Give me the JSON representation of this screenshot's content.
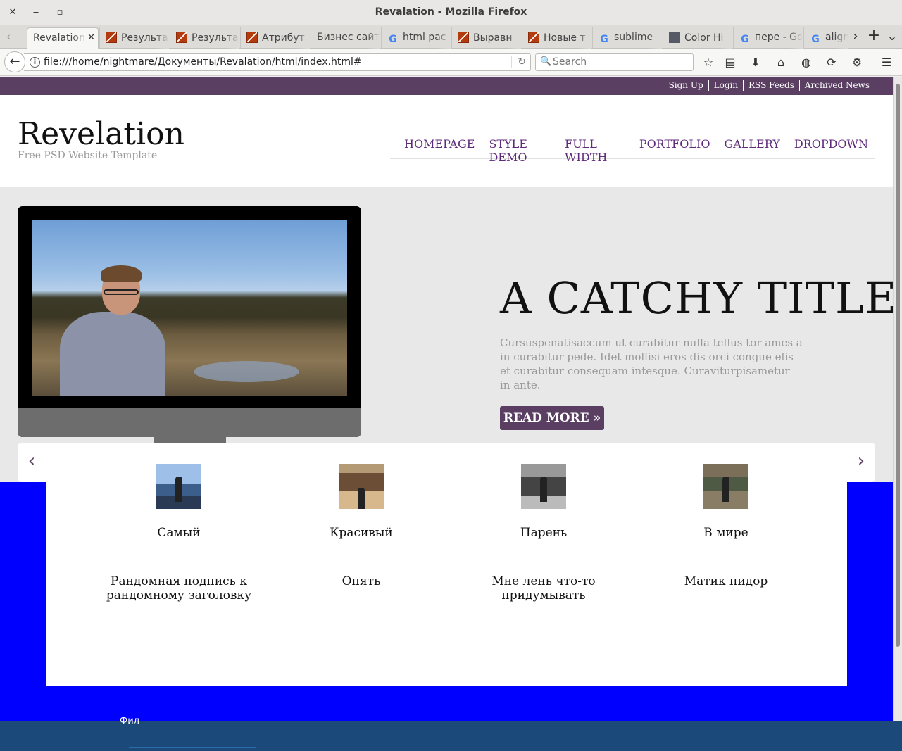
{
  "window": {
    "title": "Revalation - Mozilla Firefox",
    "close": "✕",
    "minimize": "‒",
    "maximize": "▫"
  },
  "tabs": [
    {
      "label": "Revalation",
      "active": true,
      "favicon": "none"
    },
    {
      "label": "Результа",
      "favicon": "orange-grid-icon"
    },
    {
      "label": "Результа",
      "favicon": "orange-grid-icon"
    },
    {
      "label": "Атрибут",
      "favicon": "orange-grid-icon"
    },
    {
      "label": "Бизнес сайт",
      "favicon": "none"
    },
    {
      "label": "html pac",
      "favicon": "google-icon"
    },
    {
      "label": "Выравн",
      "favicon": "orange-grid-icon"
    },
    {
      "label": "Новые т",
      "favicon": "orange-grid-icon"
    },
    {
      "label": "sublime",
      "favicon": "google-icon"
    },
    {
      "label": "Color Hi",
      "favicon": "grey-square-icon"
    },
    {
      "label": "пере - Go",
      "favicon": "google-icon"
    },
    {
      "label": "align",
      "favicon": "google-icon"
    }
  ],
  "tab_controls": {
    "close": "✕",
    "scroll_left": "‹",
    "scroll_right": "›",
    "new_tab": "+",
    "list_all": "⌄"
  },
  "navbar": {
    "back": "←",
    "url": "file:///home/nightmare/Документы/Revalation/html/index.html#",
    "reload": "↻",
    "search_placeholder": "Search",
    "info": "i",
    "search_glyph": "🔍",
    "icons": [
      "☆",
      "▤",
      "⬇",
      "⌂",
      "◍",
      "⟳",
      "⚙",
      "☰"
    ]
  },
  "page": {
    "top_links": [
      "Sign Up",
      "Login",
      "RSS Feeds",
      "Archived News"
    ],
    "site_title": "Revelation",
    "tagline": "Free PSD Website Template",
    "nav": [
      "HOMEPAGE",
      "STYLE DEMO",
      "FULL WIDTH",
      "PORTFOLIO",
      "GALLERY",
      "DROPDOWN"
    ],
    "hero": {
      "title": "A CATCHY TITLE",
      "text": "Cursuspenatisaccum ut curabitur nulla tellus tor ames a in curabitur pede. Idet mollisi eros dis orci congue elis et curabitur consequam intesque. Curaviturpisametur in ante.",
      "button": "READ MORE »"
    },
    "carousel": {
      "prev": "‹",
      "next": "›",
      "cards": [
        {
          "title": "Самый",
          "caption": "Рандомная подпись к рандомному заголовку"
        },
        {
          "title": "Красивый",
          "caption": "Опять"
        },
        {
          "title": "Парень",
          "caption": "Мне лень что-то придумывать"
        },
        {
          "title": "В мире",
          "caption": "Матик пидор"
        }
      ]
    }
  },
  "desktop_panel": {
    "partial_text": "Фил"
  },
  "colors": {
    "brand_purple": "#5a3f63",
    "nav_link": "#5e2a7a",
    "blue_band": "#0000ff",
    "desktop_panel": "#1b4a7a"
  }
}
